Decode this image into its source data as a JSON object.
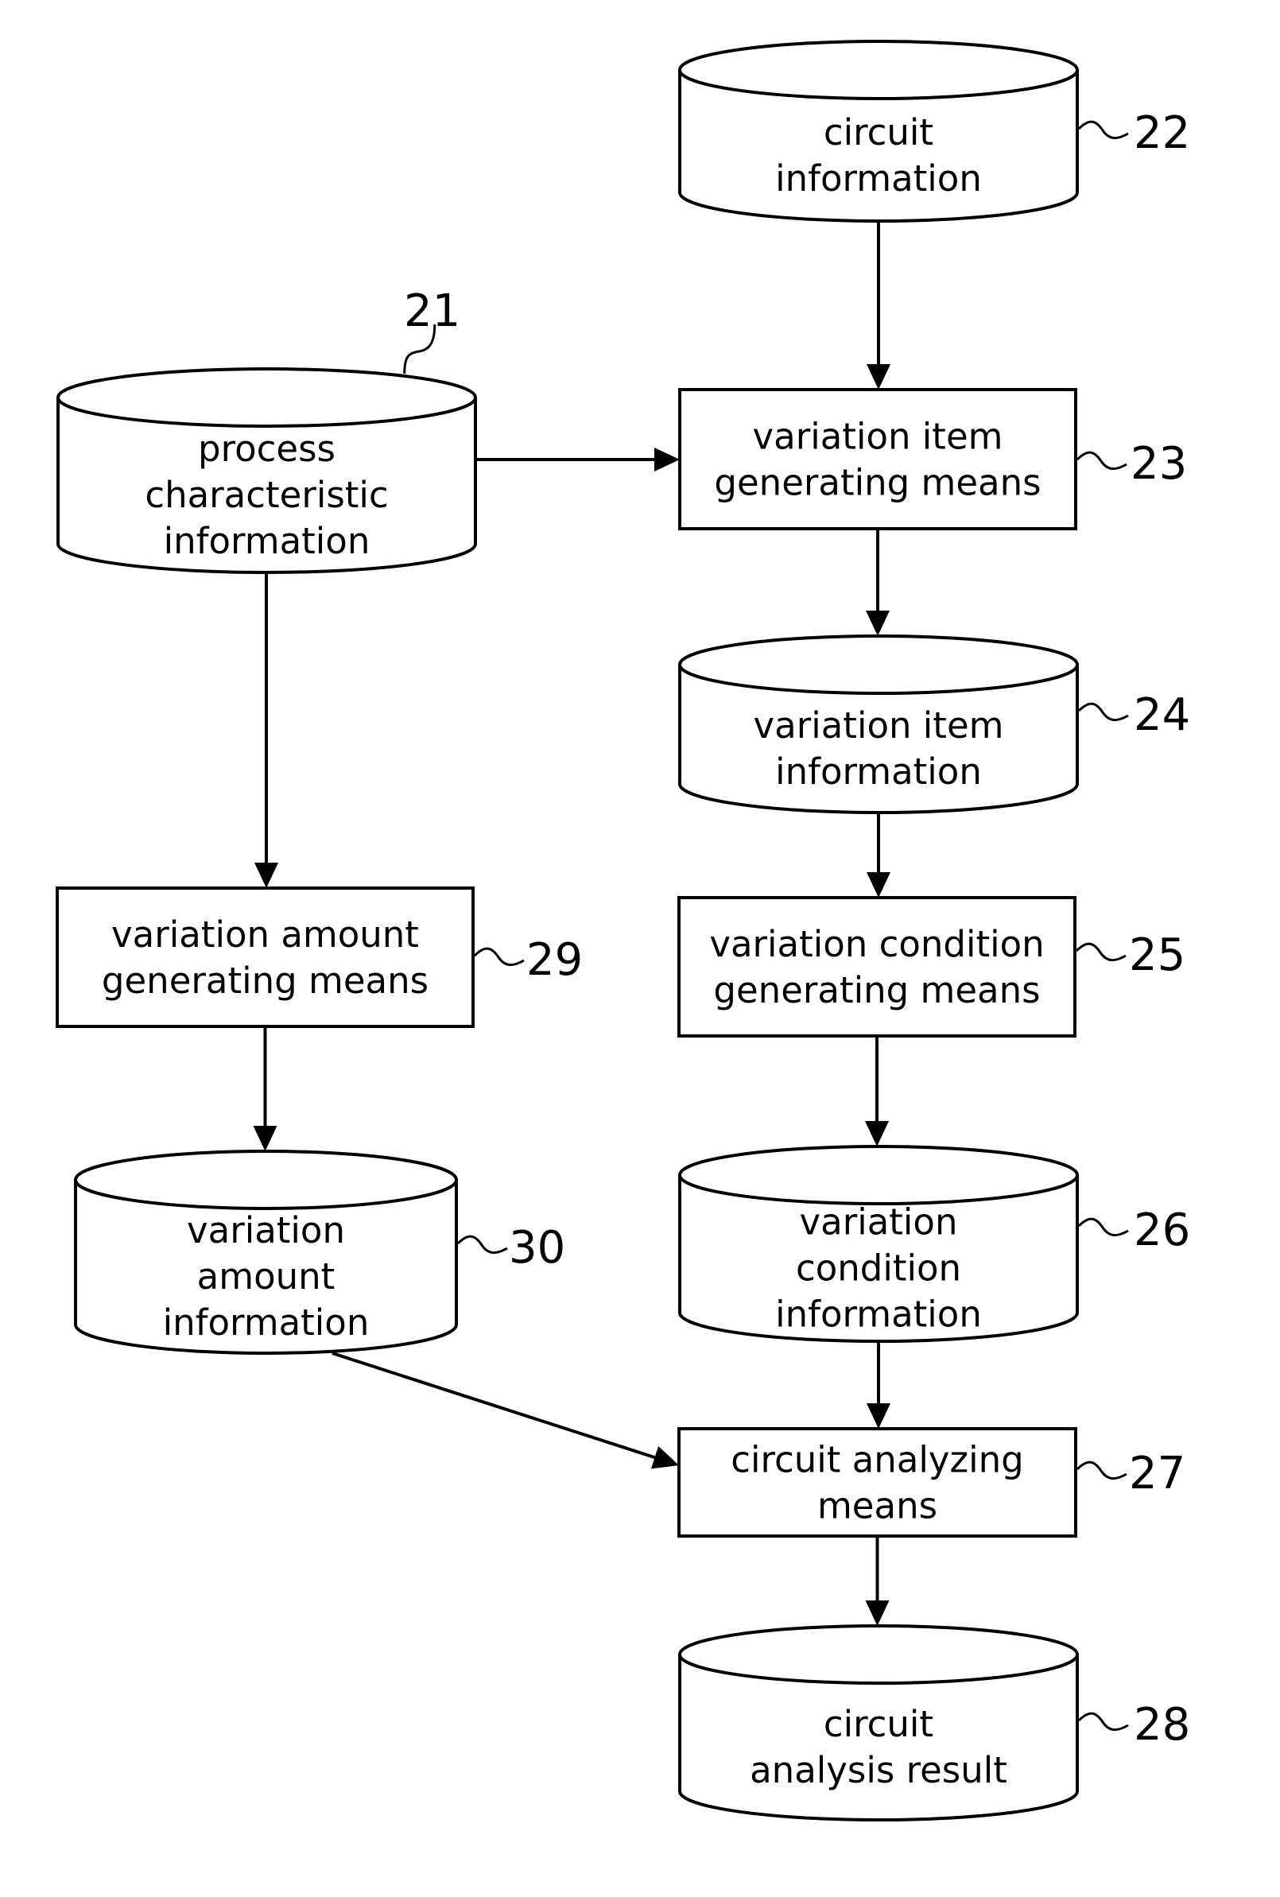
{
  "figure": {
    "nodes": [
      {
        "id": "21",
        "type": "storage",
        "lines": [
          "process",
          "characteristic",
          "information"
        ]
      },
      {
        "id": "22",
        "type": "storage",
        "lines": [
          "circuit",
          "information"
        ]
      },
      {
        "id": "23",
        "type": "process",
        "lines": [
          "variation item",
          "generating means"
        ]
      },
      {
        "id": "24",
        "type": "storage",
        "lines": [
          "variation item",
          "information"
        ]
      },
      {
        "id": "25",
        "type": "process",
        "lines": [
          "variation condition",
          "generating means"
        ]
      },
      {
        "id": "26",
        "type": "storage",
        "lines": [
          "variation",
          "condition",
          "information"
        ]
      },
      {
        "id": "27",
        "type": "process",
        "lines": [
          "circuit analyzing",
          "means"
        ]
      },
      {
        "id": "28",
        "type": "storage",
        "lines": [
          "circuit",
          "analysis result"
        ]
      },
      {
        "id": "29",
        "type": "process",
        "lines": [
          "variation amount",
          "generating means"
        ]
      },
      {
        "id": "30",
        "type": "storage",
        "lines": [
          "variation",
          "amount",
          "information"
        ]
      }
    ],
    "edges": [
      {
        "from": "22",
        "to": "23"
      },
      {
        "from": "21",
        "to": "23"
      },
      {
        "from": "23",
        "to": "24"
      },
      {
        "from": "24",
        "to": "25"
      },
      {
        "from": "25",
        "to": "26"
      },
      {
        "from": "26",
        "to": "27"
      },
      {
        "from": "27",
        "to": "28"
      },
      {
        "from": "21",
        "to": "29"
      },
      {
        "from": "29",
        "to": "30"
      },
      {
        "from": "30",
        "to": "27"
      }
    ]
  }
}
